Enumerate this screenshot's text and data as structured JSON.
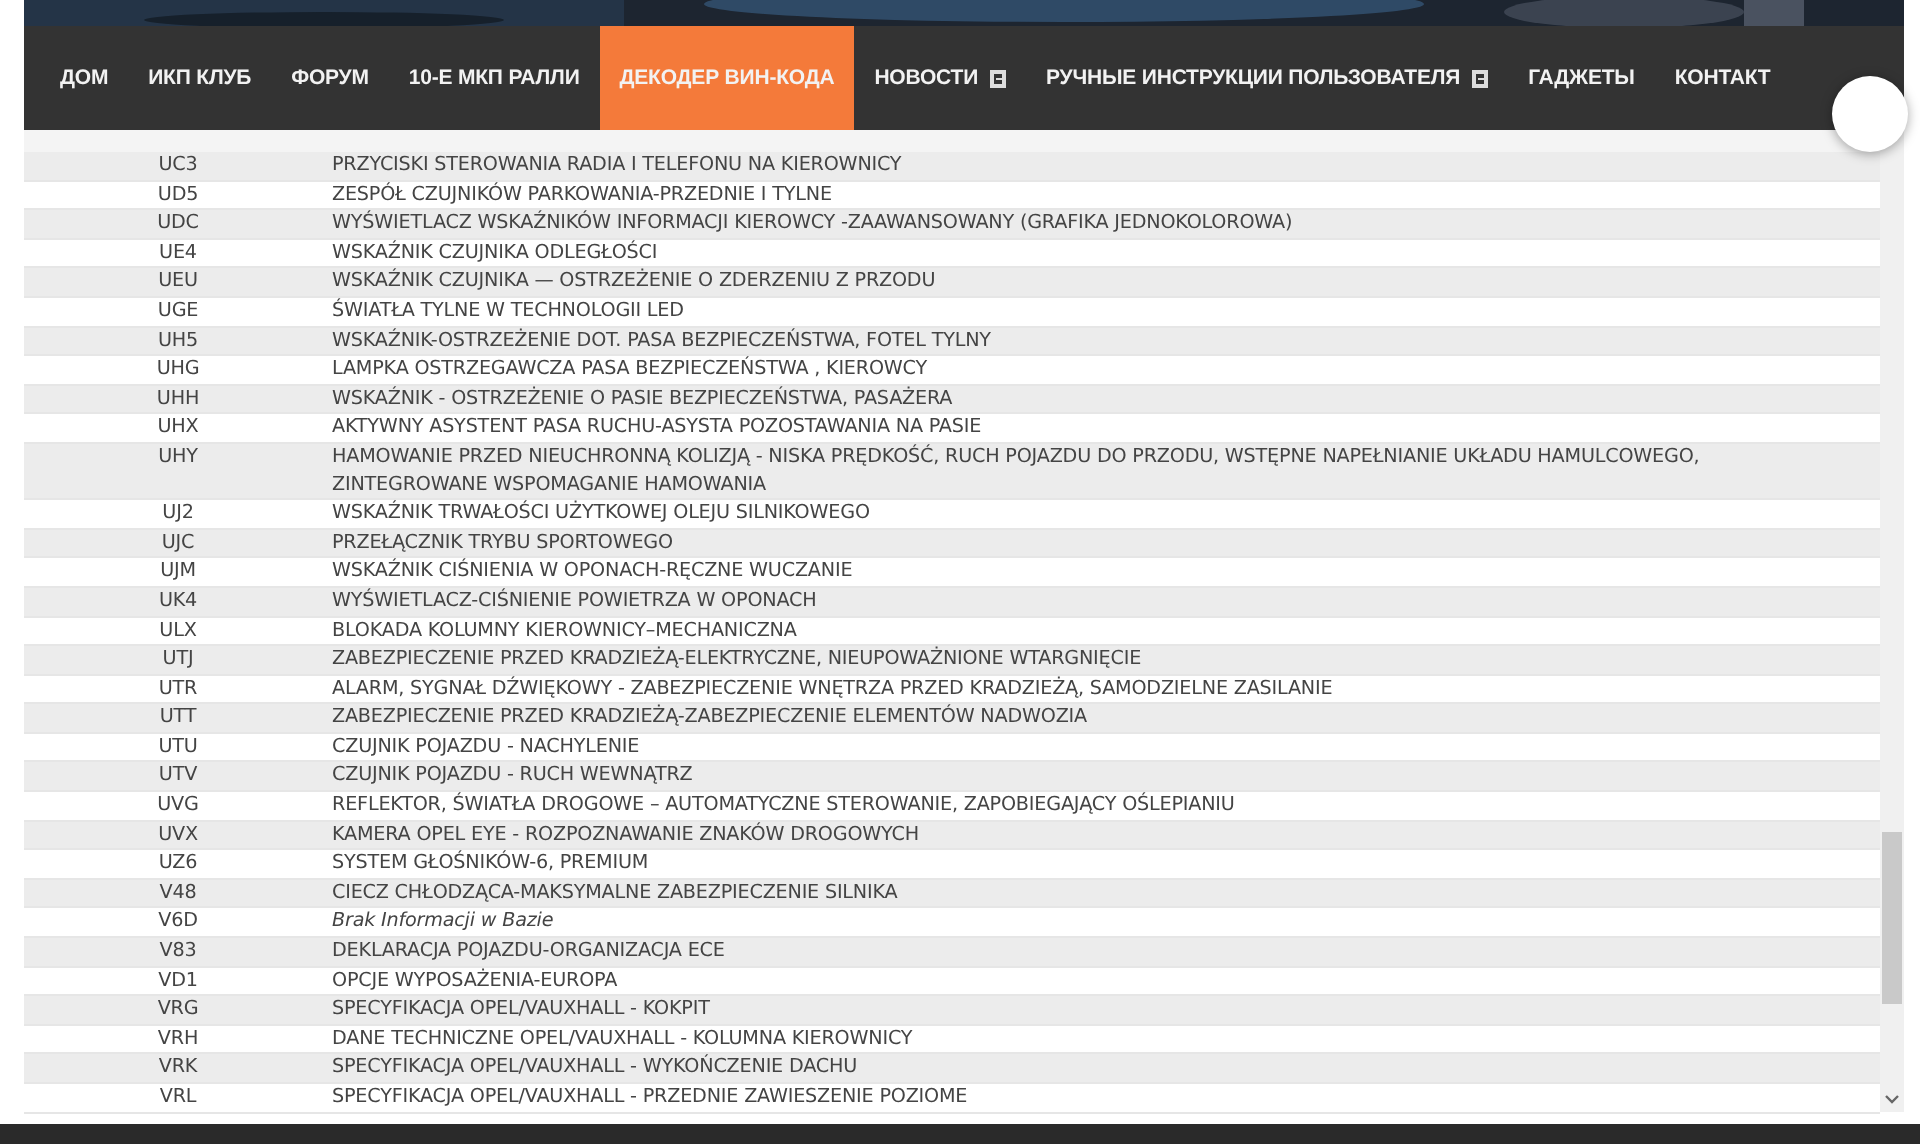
{
  "nav": {
    "items": [
      {
        "label": "ДОМ",
        "selected": false,
        "icon": false
      },
      {
        "label": "ИКП КЛУБ",
        "selected": false,
        "icon": false
      },
      {
        "label": "ФОРУМ",
        "selected": false,
        "icon": false
      },
      {
        "label": "10-Е МКП РАЛЛИ",
        "selected": false,
        "icon": false
      },
      {
        "label": "ДЕКОДЕР ВИН-КОДА",
        "selected": true,
        "icon": false
      },
      {
        "label": "НОВОСТИ",
        "selected": false,
        "icon": true
      },
      {
        "label": "РУЧНЫЕ ИНСТРУКЦИИ ПОЛЬЗОВАТЕЛЯ",
        "selected": false,
        "icon": true
      },
      {
        "label": "ГАДЖЕТЫ",
        "selected": false,
        "icon": false
      },
      {
        "label": "КОНТАКТ",
        "selected": false,
        "icon": false
      }
    ]
  },
  "table": {
    "rows": [
      {
        "code": "UC3",
        "description": "PRZYCISKI STEROWANIA RADIA I TELEFONU NA KIEROWNICY",
        "kind": "entry"
      },
      {
        "code": "UD5",
        "description": "ZESPÓŁ CZUJNIKÓW PARKOWANIA-PRZEDNIE I TYLNE",
        "kind": "entry"
      },
      {
        "code": "UDC",
        "description": "WYŚWIETLACZ WSKAŹNIKÓW INFORMACJI KIEROWCY -ZAAWANSOWANY (GRAFIKA JEDNOKOLOROWA)",
        "kind": "entry"
      },
      {
        "code": "UE4",
        "description": "WSKAŹNIK CZUJNIKA ODLEGŁOŚCI",
        "kind": "entry"
      },
      {
        "code": "UEU",
        "description": "WSKAŹNIK CZUJNIKA — OSTRZEŻENIE O ZDERZENIU Z PRZODU",
        "kind": "entry"
      },
      {
        "code": "UGE",
        "description": "ŚWIATŁA TYLNE W TECHNOLOGII LED",
        "kind": "entry"
      },
      {
        "code": "UH5",
        "description": "WSKAŹNIK-OSTRZEŻENIE DOT. PASA BEZPIECZEŃSTWA, FOTEL TYLNY",
        "kind": "entry"
      },
      {
        "code": "UHG",
        "description": "LAMPKA OSTRZEGAWCZA PASA BEZPIECZEŃSTWA , KIEROWCY",
        "kind": "entry"
      },
      {
        "code": "UHH",
        "description": "WSKAŹNIK - OSTRZEŻENIE O PASIE BEZPIECZEŃSTWA, PASAŻERA",
        "kind": "entry"
      },
      {
        "code": "UHX",
        "description": "AKTYWNY ASYSTENT PASA RUCHU-ASYSTA POZOSTAWANIA NA PASIE",
        "kind": "entry"
      },
      {
        "code": "UHY",
        "description": "HAMOWANIE PRZED NIEUCHRONNĄ KOLIZJĄ - NISKA PRĘDKOŚĆ, RUCH POJAZDU DO PRZODU, WSTĘPNE NAPEŁNIANIE UKŁADU HAMULCOWEGO, ZINTEGROWANE WSPOMAGANIE HAMOWANIA",
        "kind": "entry"
      },
      {
        "code": "UJ2",
        "description": "WSKAŹNIK TRWAŁOŚCI UŻYTKOWEJ OLEJU SILNIKOWEGO",
        "kind": "entry"
      },
      {
        "code": "UJC",
        "description": "PRZEŁĄCZNIK TRYBU SPORTOWEGO",
        "kind": "entry"
      },
      {
        "code": "UJM",
        "description": "WSKAŹNIK CIŚNIENIA W OPONACH-RĘCZNE WUCZANIE",
        "kind": "entry"
      },
      {
        "code": "UK4",
        "description": "WYŚWIETLACZ-CIŚNIENIE POWIETRZA W OPONACH",
        "kind": "entry"
      },
      {
        "code": "ULX",
        "description": "BLOKADA KOLUMNY KIEROWNICY–MECHANICZNA",
        "kind": "entry"
      },
      {
        "code": "UTJ",
        "description": "ZABEZPIECZENIE PRZED KRADZIEŻĄ-ELEKTRYCZNE, NIEUPOWAŻNIONE WTARGNIĘCIE",
        "kind": "entry"
      },
      {
        "code": "UTR",
        "description": "ALARM, SYGNAŁ DŹWIĘKOWY - ZABEZPIECZENIE WNĘTRZA PRZED KRADZIEŻĄ, SAMODZIELNE ZASILANIE",
        "kind": "entry"
      },
      {
        "code": "UTT",
        "description": "ZABEZPIECZENIE PRZED KRADZIEŻĄ-ZABEZPIECZENIE ELEMENTÓW NADWOZIA",
        "kind": "entry"
      },
      {
        "code": "UTU",
        "description": "CZUJNIK POJAZDU - NACHYLENIE",
        "kind": "entry"
      },
      {
        "code": "UTV",
        "description": "CZUJNIK POJAZDU - RUCH WEWNĄTRZ",
        "kind": "entry"
      },
      {
        "code": "UVG",
        "description": "REFLEKTOR, ŚWIATŁA DROGOWE – AUTOMATYCZNE STEROWANIE, ZAPOBIEGAJĄCY OŚLEPIANIU",
        "kind": "entry"
      },
      {
        "code": "UVX",
        "description": "KAMERA OPEL EYE - ROZPOZNAWANIE ZNAKÓW DROGOWYCH",
        "kind": "entry"
      },
      {
        "code": "UZ6",
        "description": "SYSTEM GŁOŚNIKÓW-6, PREMIUM",
        "kind": "entry"
      },
      {
        "code": "V48",
        "description": "CIECZ CHŁODZĄCA-MAKSYMALNE ZABEZPIECZENIE SILNIKA",
        "kind": "entry"
      },
      {
        "code": "V6D",
        "description": "Brak Informacji w Bazie",
        "kind": "missing"
      },
      {
        "code": "V83",
        "description": "DEKLARACJA POJAZDU-ORGANIZACJA ECE",
        "kind": "entry"
      },
      {
        "code": "VD1",
        "description": "OPCJE WYPOSAŻENIA-EUROPA",
        "kind": "entry"
      },
      {
        "code": "VRG",
        "description": "SPECYFIKACJA OPEL/VAUXHALL - KOKPIT",
        "kind": "entry"
      },
      {
        "code": "VRH",
        "description": "DANE TECHNICZNE OPEL/VAUXHALL - KOLUMNA KIEROWNICY",
        "kind": "entry"
      },
      {
        "code": "VRK",
        "description": "SPECYFIKACJA OPEL/VAUXHALL - WYKOŃCZENIE DACHU",
        "kind": "entry"
      },
      {
        "code": "VRL",
        "description": "SPECYFIKACJA OPEL/VAUXHALL - PRZEDNIE ZAWIESZENIE POZIOME",
        "kind": "entry"
      }
    ]
  }
}
